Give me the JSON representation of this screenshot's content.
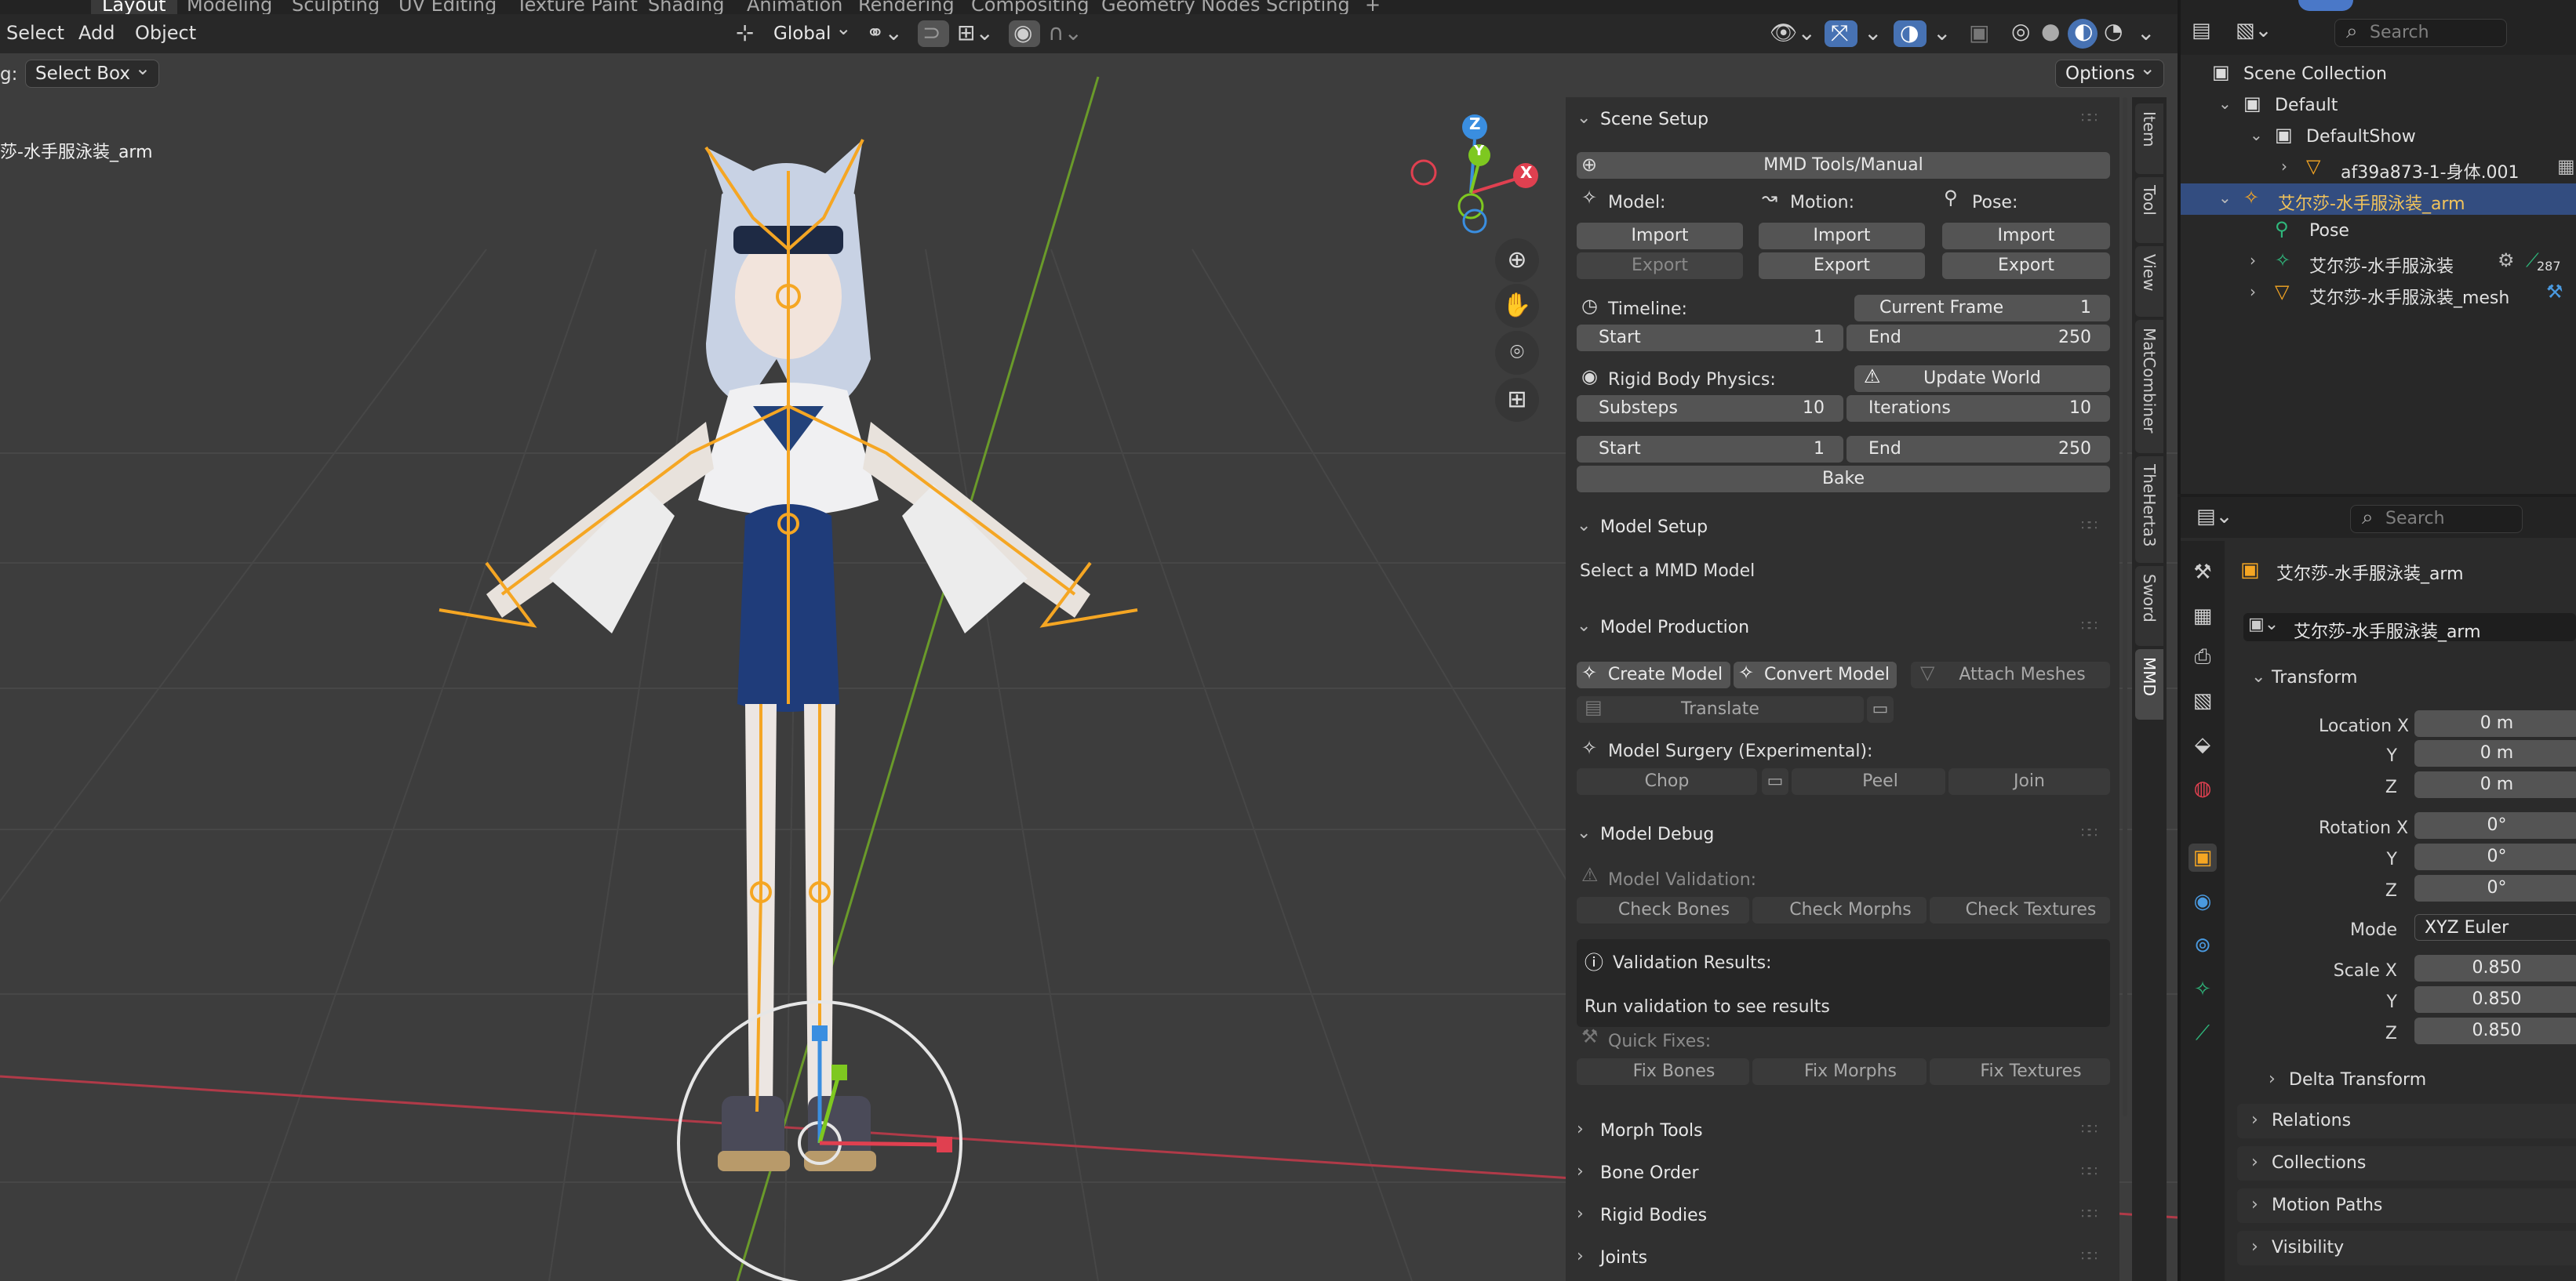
{
  "workspace_tabs": [
    "Layout",
    "Modeling",
    "Sculpting",
    "UV Editing",
    "Texture Paint",
    "Shading",
    "Animation",
    "Rendering",
    "Compositing",
    "Geometry Nodes",
    "Scripting",
    "+"
  ],
  "viewport": {
    "menus": [
      "Select",
      "Add",
      "Object"
    ],
    "transform_orientation": "Global",
    "tool_prefix": "g:",
    "tool_select": "Select Box",
    "options": "Options",
    "object_label": "莎-水手服泳装_arm",
    "gizmo_axes": {
      "x": "X",
      "y": "Y",
      "z": "Z"
    }
  },
  "mmd_panel": {
    "scene_setup": {
      "title": "Scene Setup",
      "manual_button": "MMD Tools/Manual",
      "model_label": "Model:",
      "motion_label": "Motion:",
      "pose_label": "Pose:",
      "import": "Import",
      "export": "Export",
      "timeline_label": "Timeline:",
      "current_frame_label": "Current Frame",
      "current_frame": "1",
      "start_label": "Start",
      "start": "1",
      "end_label": "End",
      "end": "250",
      "rigid_label": "Rigid Body Physics:",
      "update_world": "Update World",
      "substeps_label": "Substeps",
      "substeps": "10",
      "iterations_label": "Iterations",
      "iterations": "10",
      "rb_start": "1",
      "rb_end": "250",
      "bake": "Bake"
    },
    "model_setup": {
      "title": "Model Setup",
      "hint": "Select a MMD Model"
    },
    "model_production": {
      "title": "Model Production",
      "create_model": "Create Model",
      "convert_model": "Convert Model",
      "attach_meshes": "Attach Meshes",
      "translate": "Translate",
      "surgery_label": "Model Surgery (Experimental):",
      "chop": "Chop",
      "peel": "Peel",
      "join": "Join"
    },
    "model_debug": {
      "title": "Model Debug",
      "validation_label": "Model Validation:",
      "check_bones": "Check Bones",
      "check_morphs": "Check Morphs",
      "check_textures": "Check Textures",
      "results_title": "Validation Results:",
      "results_text": "Run validation to see results",
      "quick_fixes": "Quick Fixes:",
      "fix_bones": "Fix Bones",
      "fix_morphs": "Fix Morphs",
      "fix_textures": "Fix Textures"
    },
    "collapsed_sections": [
      "Morph Tools",
      "Bone Order",
      "Rigid Bodies",
      "Joints"
    ]
  },
  "vertical_tabs": [
    "Item",
    "Tool",
    "View",
    "MatCombiner",
    "TheHerta3",
    "Sword",
    "MMD"
  ],
  "outliner": {
    "search_placeholder": "Search",
    "rows": [
      {
        "text": "Scene Collection",
        "indent": 0
      },
      {
        "text": "Default",
        "indent": 1
      },
      {
        "text": "DefaultShow",
        "indent": 2
      },
      {
        "text": "af39a873-1-身体.001",
        "indent": 3
      },
      {
        "text": "艾尔莎-水手服泳装_arm",
        "indent": 1
      },
      {
        "text": "Pose",
        "indent": 2
      },
      {
        "text": "艾尔莎-水手服泳装",
        "indent": 2
      },
      {
        "text": "艾尔莎-水手服泳装_mesh",
        "indent": 2
      }
    ],
    "badge_count": "287"
  },
  "properties": {
    "search_placeholder": "Search",
    "object_name": "艾尔莎-水手服泳装_arm",
    "object_field": "艾尔莎-水手服泳装_arm",
    "transform_title": "Transform",
    "location_label": "Location X",
    "rotation_label": "Rotation X",
    "scale_label": "Scale X",
    "y_label": "Y",
    "z_label": "Z",
    "location": [
      "0 m",
      "0 m",
      "0 m"
    ],
    "rotation": [
      "0°",
      "0°",
      "0°"
    ],
    "mode_label": "Mode",
    "mode": "XYZ Euler",
    "scale": [
      "0.850",
      "0.850",
      "0.850"
    ],
    "sections": [
      "Delta Transform",
      "Relations",
      "Collections",
      "Motion Paths",
      "Visibility"
    ]
  },
  "colors": {
    "accent_blue": "#4772b3",
    "selection_orange": "#f2c35a",
    "armature_orange": "#f5a623",
    "axis_x": "#e04050",
    "axis_y": "#7ec820",
    "axis_z": "#3a8ee0"
  }
}
